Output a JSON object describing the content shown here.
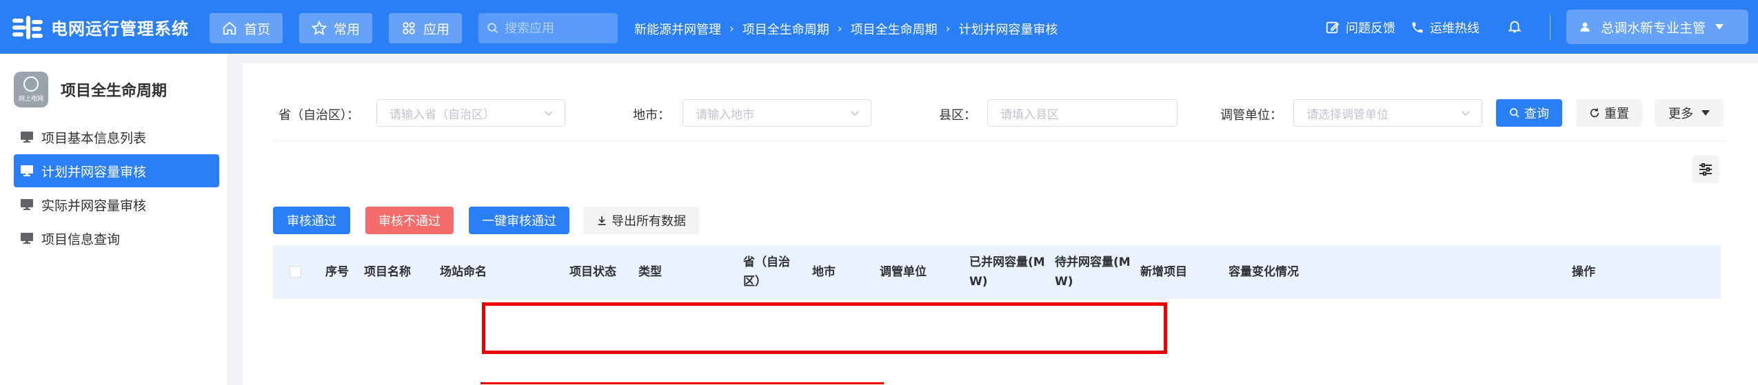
{
  "app": {
    "title": "电网运行管理系统"
  },
  "header": {
    "nav": [
      {
        "label": "首页",
        "icon": "home-icon"
      },
      {
        "label": "常用",
        "icon": "star-icon"
      },
      {
        "label": "应用",
        "icon": "apps-icon"
      }
    ],
    "search": {
      "placeholder": "搜索应用"
    },
    "breadcrumb": [
      "新能源并网管理",
      "项目全生命周期",
      "项目全生命周期",
      "计划并网容量审核"
    ],
    "feedback": "问题反馈",
    "hotline": "运维热线",
    "user": "总调水新专业主管"
  },
  "sidebar": {
    "module_title": "项目全生命周期",
    "module_icon_text": "网上电网",
    "items": [
      {
        "label": "项目基本信息列表",
        "active": false
      },
      {
        "label": "计划并网容量审核",
        "active": true
      },
      {
        "label": "实际并网容量审核",
        "active": false
      },
      {
        "label": "项目信息查询",
        "active": false
      }
    ]
  },
  "filters": {
    "province": {
      "label": "省（自治区）：",
      "placeholder": "请输入省（自治区）"
    },
    "city": {
      "label": "地市：",
      "placeholder": "请输入地市"
    },
    "county": {
      "label": "县区：",
      "placeholder": "请填入县区"
    },
    "unit": {
      "label": "调管单位：",
      "placeholder": "请选择调管单位"
    },
    "query": "查询",
    "reset": "重置",
    "more": "更多"
  },
  "actions": {
    "approve": "审核通过",
    "reject": "审核不通过",
    "approve_all": "一键审核通过",
    "export": "导出所有数据"
  },
  "table": {
    "headers": {
      "seq": "序号",
      "name": "项目名称",
      "station": "场站命名",
      "status": "项目状态",
      "type": "类型",
      "province_l1": "省（自治",
      "province_l2": "区）",
      "city": "地市",
      "unit": "调管单位",
      "connected_l1": "已并网容量(M",
      "connected_l2": "W)",
      "pending_l1": "待并网容量(M",
      "pending_l2": "W)",
      "new_project": "新增项目",
      "capacity_change": "容量变化情况",
      "ops": "操作"
    }
  },
  "colors": {
    "primary": "#2b7ff5",
    "danger": "#f56c6c",
    "highlight": "#ee0000"
  }
}
